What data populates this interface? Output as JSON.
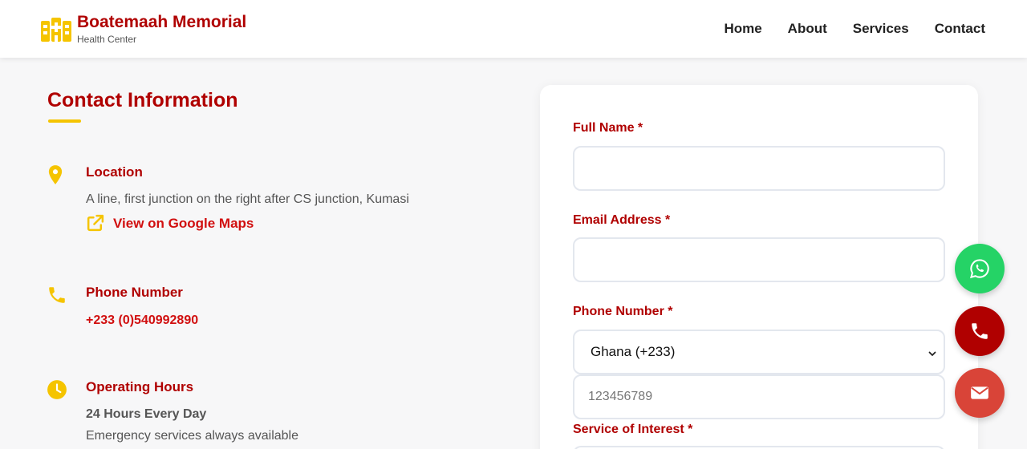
{
  "brand": {
    "name": "Boatemaah Memorial",
    "subtitle": "Health Center"
  },
  "nav": {
    "items": [
      "Home",
      "About",
      "Services",
      "Contact"
    ]
  },
  "contact_info": {
    "title": "Contact Information",
    "location": {
      "label": "Location",
      "address": "A line, first junction on the right after CS junction, Kumasi",
      "maps_link": "View on Google Maps"
    },
    "phone": {
      "label": "Phone Number",
      "number": "+233 (0)540992890"
    },
    "hours": {
      "label": "Operating Hours",
      "schedule": "24 Hours Every Day",
      "note": "Emergency services always available"
    }
  },
  "form": {
    "full_name": {
      "label": "Full Name *",
      "value": "",
      "placeholder": ""
    },
    "email": {
      "label": "Email Address *",
      "value": "",
      "placeholder": ""
    },
    "phone": {
      "label": "Phone Number *",
      "country_selected": "Ghana (+233)",
      "placeholder": "123456789"
    },
    "service": {
      "label": "Service of Interest *"
    }
  },
  "fab": {
    "whatsapp_icon": "whatsapp-icon",
    "phone_icon": "phone-icon",
    "email_icon": "envelope-icon"
  },
  "colors": {
    "primary_red": "#b00000",
    "link_red": "#d10f0f",
    "accent_yellow": "#f5c400",
    "whatsapp_green": "#25d366",
    "call_red": "#b00000",
    "email_red": "#d94438"
  }
}
